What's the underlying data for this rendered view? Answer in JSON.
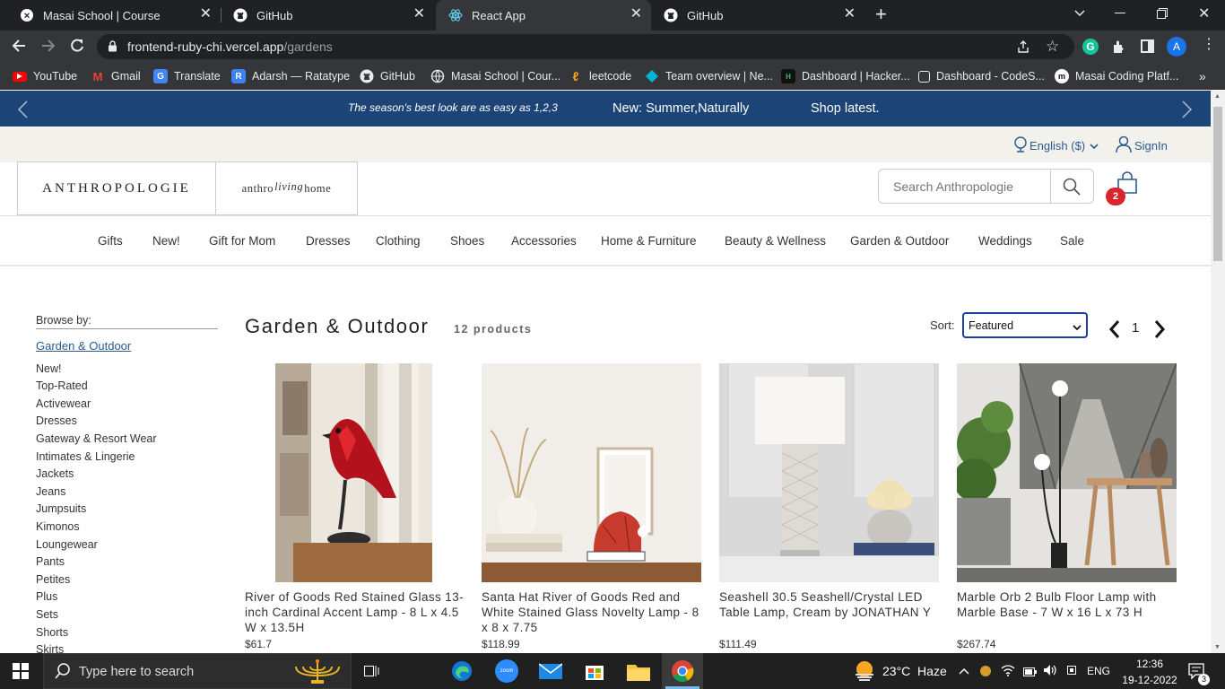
{
  "browser": {
    "tabs": [
      {
        "title": "Masai School | Course",
        "active": false
      },
      {
        "title": "GitHub",
        "active": false
      },
      {
        "title": "React App",
        "active": true
      },
      {
        "title": "GitHub",
        "active": false
      }
    ],
    "url_main": "frontend-ruby-chi.vercel.app",
    "url_path": "/gardens",
    "profile_letter": "A",
    "bookmarks": [
      {
        "label": "YouTube",
        "icon": "youtube-icon"
      },
      {
        "label": "Gmail",
        "icon": "gmail-icon"
      },
      {
        "label": "Translate",
        "icon": "translate-icon"
      },
      {
        "label": "Adarsh — Ratatype",
        "icon": "ratatype-icon"
      },
      {
        "label": "GitHub",
        "icon": "github-icon"
      },
      {
        "label": "Masai School | Cour...",
        "icon": "masai-icon"
      },
      {
        "label": "leetcode",
        "icon": "leetcode-icon"
      },
      {
        "label": "Team overview | Ne...",
        "icon": "team-icon"
      },
      {
        "label": "Dashboard | Hacker...",
        "icon": "hackerrank-icon"
      },
      {
        "label": "Dashboard - CodeS...",
        "icon": "codesignal-icon"
      },
      {
        "label": "Masai Coding Platf...",
        "icon": "masai-coding-icon"
      }
    ]
  },
  "promo": {
    "left_text": "The season's best look are as easy as 1,2,3",
    "center_text": "New: Summer,Naturally",
    "right_text": "Shop latest."
  },
  "utility": {
    "language": "English ($)",
    "signin": "SignIn"
  },
  "header": {
    "logo": "ANTHROPOLOGIE",
    "logo2_left": "anthro",
    "logo2_mid": "living",
    "logo2_right": "home",
    "search_placeholder": "Search Anthropologie",
    "cart_count": "2"
  },
  "nav": [
    "Gifts",
    "New!",
    "Gift for Mom",
    "Dresses",
    "Clothing",
    "Shoes",
    "Accessories",
    "Home & Furniture",
    "Beauty & Wellness",
    "Garden & Outdoor",
    "Weddings",
    "Sale"
  ],
  "sidebar": {
    "browse_label": "Browse by:",
    "current": "Garden & Outdoor",
    "items": [
      "New!",
      "Top-Rated",
      "Activewear",
      "Dresses",
      "Gateway & Resort Wear",
      "Intimates & Lingerie",
      "Jackets",
      "Jeans",
      "Jumpsuits",
      "Kimonos",
      "Loungewear",
      "Pants",
      "Petites",
      "Plus",
      "Sets",
      "Shorts",
      "Skirts"
    ]
  },
  "listing": {
    "title": "Garden & Outdoor",
    "count": "12 products",
    "sort_label": "Sort:",
    "sort_value": "Featured",
    "page": "1"
  },
  "products": [
    {
      "title": "River of Goods Red Stained Glass 13-inch Cardinal Accent Lamp - 8 L x 4.5 W x 13.5H",
      "price": "$61.7"
    },
    {
      "title": "Santa Hat River of Goods Red and White Stained Glass Novelty Lamp - 8 x 8 x 7.75",
      "price": "$118.99"
    },
    {
      "title": "Seashell 30.5 Seashell/Crystal LED Table Lamp, Cream by JONATHAN Y",
      "price": "$111.49"
    },
    {
      "title": "Marble Orb 2 Bulb Floor Lamp with Marble Base - 7 W x 16 L x 73 H",
      "price": "$267.74"
    }
  ],
  "taskbar": {
    "search_placeholder": "Type here to search",
    "weather": "23°C  Haze",
    "lang": "ENG",
    "time": "12:36",
    "date": "19-12-2022",
    "notifications": "3"
  },
  "colors": {
    "promo_bg": "#1d4477",
    "accent_blue": "#2b5a8f",
    "cart_badge": "#d9262e"
  }
}
